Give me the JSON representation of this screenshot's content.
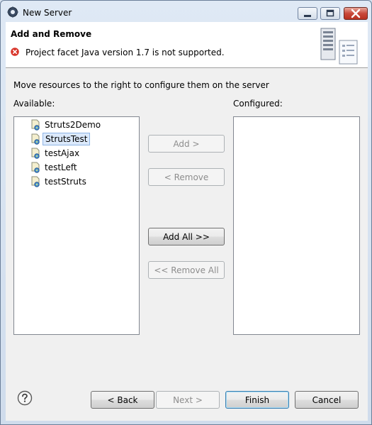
{
  "window": {
    "title": "New Server",
    "icons": {
      "app": "server-gear-icon",
      "minimize": "minimize-icon",
      "maximize": "maximize-icon",
      "close": "close-icon"
    }
  },
  "header": {
    "title": "Add and Remove",
    "error_message": "Project facet Java version 1.7 is not supported.",
    "error_icon": "error-icon",
    "banner_icon": "server-wizard-banner-icon"
  },
  "main": {
    "instruction": "Move resources to the right to configure them on the server",
    "available_label": "Available:",
    "configured_label": "Configured:",
    "available_items": [
      {
        "label": "Struts2Demo",
        "icon": "web-project-icon",
        "selected": false
      },
      {
        "label": "StrutsTest",
        "icon": "web-project-icon",
        "selected": true
      },
      {
        "label": "testAjax",
        "icon": "web-project-icon",
        "selected": false
      },
      {
        "label": "testLeft",
        "icon": "web-project-icon",
        "selected": false
      },
      {
        "label": "testStruts",
        "icon": "web-project-icon",
        "selected": false
      }
    ],
    "configured_items": [],
    "buttons": {
      "add": "Add >",
      "remove": "< Remove",
      "add_all": "Add All >>",
      "remove_all": "<< Remove All"
    }
  },
  "footer": {
    "help_icon": "help-icon",
    "back": "< Back",
    "next": "Next >",
    "finish": "Finish",
    "cancel": "Cancel"
  },
  "colors": {
    "selection_bg": "#dbe9fb",
    "selection_border": "#8fb5e5",
    "error_red": "#d9362b",
    "close_button": "#c9483a"
  }
}
